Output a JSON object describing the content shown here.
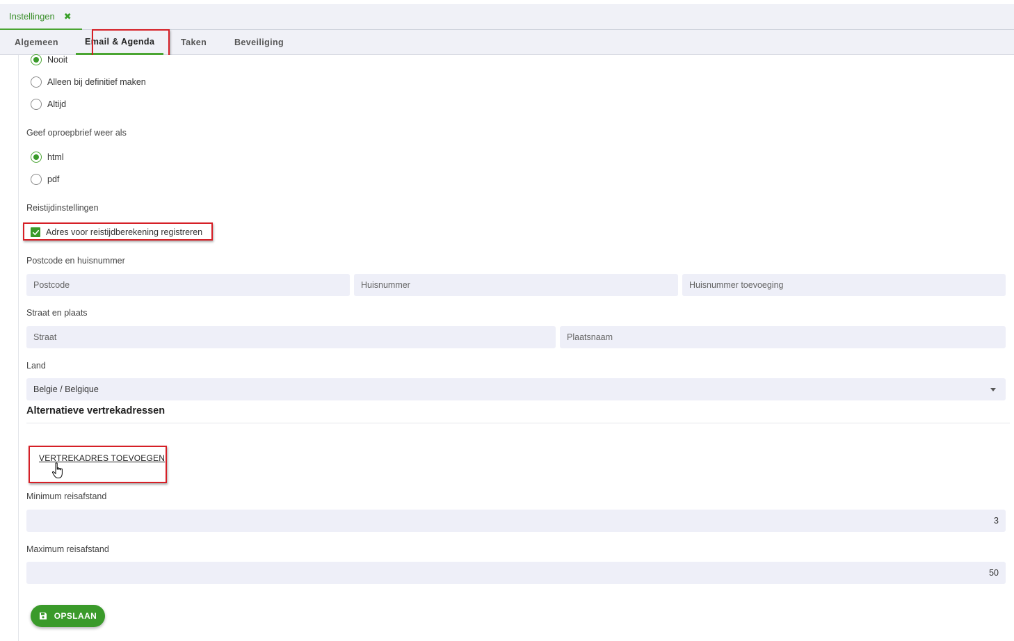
{
  "tab": {
    "label": "Instellingen",
    "close_glyph": "✖"
  },
  "subtabs": [
    {
      "label": "Algemeen"
    },
    {
      "label": "Email & Agenda"
    },
    {
      "label": "Taken"
    },
    {
      "label": "Beveiliging"
    }
  ],
  "send_options": [
    {
      "label": "Nooit",
      "selected": true
    },
    {
      "label": "Alleen bij definitief maken",
      "selected": false
    },
    {
      "label": "Altijd",
      "selected": false
    }
  ],
  "format": {
    "label": "Geef oproepbrief weer als",
    "options": [
      {
        "label": "html",
        "selected": true
      },
      {
        "label": "pdf",
        "selected": false
      }
    ]
  },
  "travel": {
    "section_label": "Reistijdinstellingen",
    "checkbox_label": "Adres voor reistijdberekening registreren",
    "checked": true
  },
  "address": {
    "postcode_label": "Postcode en huisnummer",
    "postcode_placeholder": "Postcode",
    "huisnummer_placeholder": "Huisnummer",
    "toevoeging_placeholder": "Huisnummer toevoeging",
    "street_label": "Straat en plaats",
    "street_placeholder": "Straat",
    "city_placeholder": "Plaatsnaam",
    "country_label": "Land",
    "country_value": "Belgie / Belgique"
  },
  "alt": {
    "title": "Alternatieve vertrekadressen",
    "add_link": "VERTREKADRES TOEVOEGEN"
  },
  "distance": {
    "min_label": "Minimum reisafstand",
    "min_value": "3",
    "max_label": "Maximum reisafstand",
    "max_value": "50"
  },
  "save": {
    "label": "OPSLAAN"
  },
  "colors": {
    "accent": "#3a9a2a",
    "highlight": "#d61f26",
    "field_bg": "#eeeff8"
  }
}
